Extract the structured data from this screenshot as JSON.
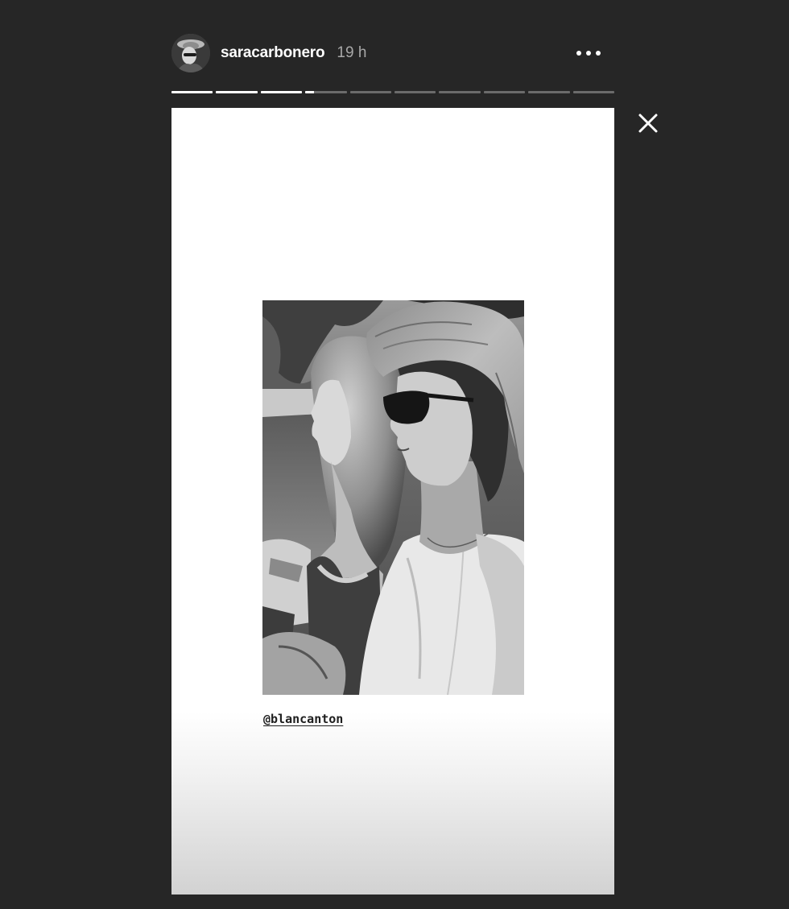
{
  "header": {
    "username": "saracarbonero",
    "time": "19 h",
    "avatar_icon": "profile-avatar",
    "more_icon": "more-horizontal-icon"
  },
  "progress": {
    "segments": [
      1,
      1,
      1,
      0.2,
      0,
      0,
      0,
      0,
      0,
      0
    ],
    "active_color": "#ffffff",
    "inactive_color": "#6b6b6b"
  },
  "close_icon": "close-icon",
  "story": {
    "photo": "black-and-white-photo-two-women-park",
    "mention": "@blancanton"
  },
  "colors": {
    "background": "#262626",
    "story_background": "#ffffff",
    "username": "#ffffff",
    "time": "#a8a8a8"
  }
}
